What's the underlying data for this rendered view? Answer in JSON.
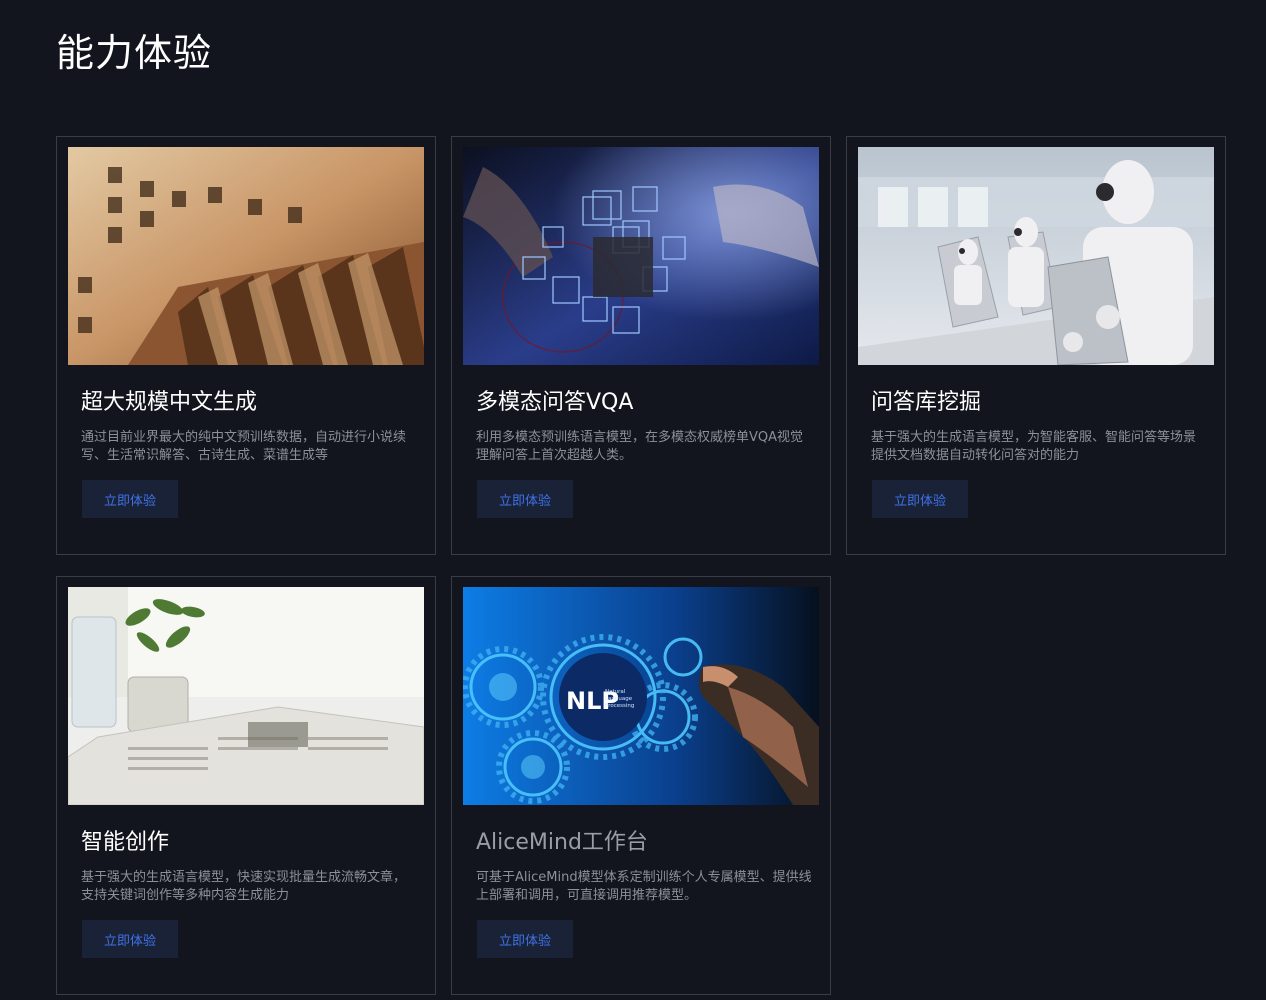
{
  "page": {
    "title": "能力体验"
  },
  "cards": [
    {
      "title": "超大规模中文生成",
      "description": "通过目前业界最大的纯中文预训练数据，自动进行小说续写、生活常识解答、古诗生成、菜谱生成等",
      "button_label": "立即体验",
      "image": "movable-type-printing-photo"
    },
    {
      "title": "多模态问答VQA",
      "description": "利用多模态预训练语言模型，在多模态权威榜单VQA视觉理解问答上首次超越人类。",
      "button_label": "立即体验",
      "image": "hands-cube-network-photo"
    },
    {
      "title": "问答库挖掘",
      "description": "基于强大的生成语言模型，为智能客服、智能问答等场景提供文档数据自动转化问答对的能力",
      "button_label": "立即体验",
      "image": "robots-with-laptops-photo"
    },
    {
      "title": "智能创作",
      "description": "基于强大的生成语言模型，快速实现批量生成流畅文章，支持关键词创作等多种内容生成能力",
      "button_label": "立即体验",
      "image": "newspaper-plant-photo"
    },
    {
      "title": "AliceMind工作台",
      "description": "可基于AliceMind模型体系定制训练个人专属模型、提供线上部署和调用，可直接调用推荐模型。",
      "button_label": "立即体验",
      "image": "nlp-gears-hand-photo",
      "nlp_badge": "NLP",
      "nlp_caption": [
        "Natural",
        "Language",
        "Processing"
      ]
    }
  ],
  "colors": {
    "background": "#12151d",
    "card_border": "#3a3d45",
    "button_bg": "#1a2238",
    "button_text": "#3f72e8"
  }
}
